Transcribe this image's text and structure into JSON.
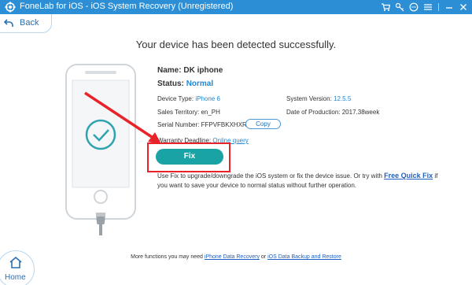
{
  "window": {
    "title": "FoneLab for iOS - iOS System Recovery (Unregistered)"
  },
  "toolbar": {
    "back_label": "Back"
  },
  "main": {
    "headline": "Your device has been detected successfully.",
    "name_label": "Name:",
    "name_value": "DK iphone",
    "status_label": "Status:",
    "status_value": "Normal",
    "device_type_label": "Device Type:",
    "device_type_value": "iPhone 6",
    "system_version_label": "System Version:",
    "system_version_value": "12.5.5",
    "sales_territory_label": "Sales Territory:",
    "sales_territory_value": "en_PH",
    "date_production_label": "Date of Production:",
    "date_production_value": "2017.38week",
    "serial_label": "Serial Number:",
    "serial_value": "FFPVFBKXHXR6",
    "copy_label": "Copy",
    "warranty_label": "Warranty Deadline:",
    "warranty_link": "Online query",
    "fix_label": "Fix",
    "desc_line1_pre": "Use Fix to upgrade/downgrade the iOS system or fix the device issue. Or try with",
    "desc_link": "Free Quick Fix",
    "desc_line1_post": "if",
    "desc_line2": "you want to save your device to normal status without further operation."
  },
  "footer": {
    "prefix": "More functions you may need",
    "link1": "iPhone Data Recovery",
    "separator": "or",
    "link2": "iOS Data Backup and Restore"
  },
  "nav": {
    "home_label": "Home"
  },
  "colors": {
    "titlebar": "#2c8fd6",
    "fix_button": "#1aa3a4",
    "highlight": "#e8232a",
    "link": "#1f87d6"
  },
  "icons": [
    "app-logo-icon",
    "cart-icon",
    "key-icon",
    "chat-icon",
    "menu-icon",
    "minimize-icon",
    "close-icon",
    "back-arrow-icon",
    "checkmark-icon",
    "home-icon"
  ]
}
